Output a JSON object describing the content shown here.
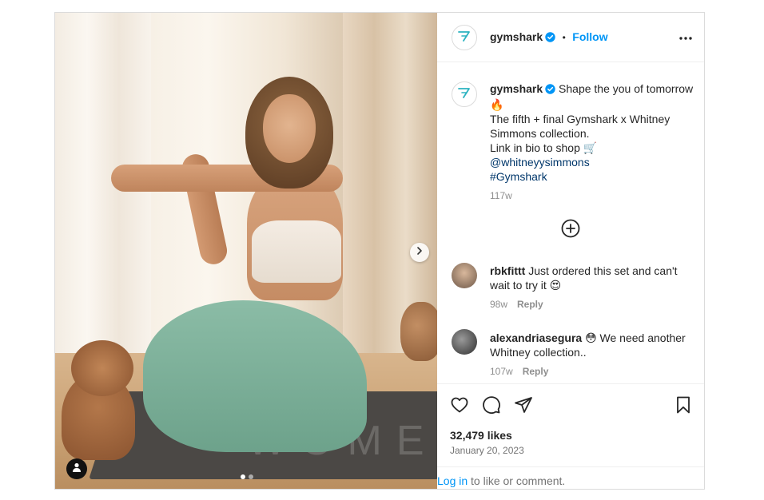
{
  "post": {
    "account": {
      "username": "gymshark",
      "follow_label": "Follow",
      "separator": "•",
      "avatar_icon": "gymshark-logo-icon"
    },
    "media": {
      "mat_text": "WOMEN",
      "carousel_index": 1,
      "carousel_total": 2
    },
    "caption": {
      "username": "gymshark",
      "lines": [
        "Shape the you of tomorrow",
        "🔥",
        "The fifth + final Gymshark x Whitney",
        "Simmons collection.",
        "Link in bio to shop 🛒",
        "@whitneyysimmons",
        "#Gymshark"
      ],
      "time": "117w"
    },
    "comments": [
      {
        "username": "rbkfittt",
        "text_line1": "Just ordered this set and can't",
        "text_line2": "wait to try it 😍",
        "time": "98w",
        "reply_label": "Reply"
      },
      {
        "username": "alexandriasegura",
        "text_line1": "😳 We need another",
        "text_line2": "Whitney collection..",
        "time": "107w",
        "reply_label": "Reply"
      }
    ],
    "engagement": {
      "likes": "32,479 likes",
      "date": "January 20, 2023"
    },
    "login_prompt": {
      "link": "Log in",
      "rest": " to like or comment."
    },
    "colors": {
      "accent": "#0095f6",
      "verified": "#0095f6",
      "link": "#00376b",
      "muted": "#8e8e8e"
    }
  }
}
